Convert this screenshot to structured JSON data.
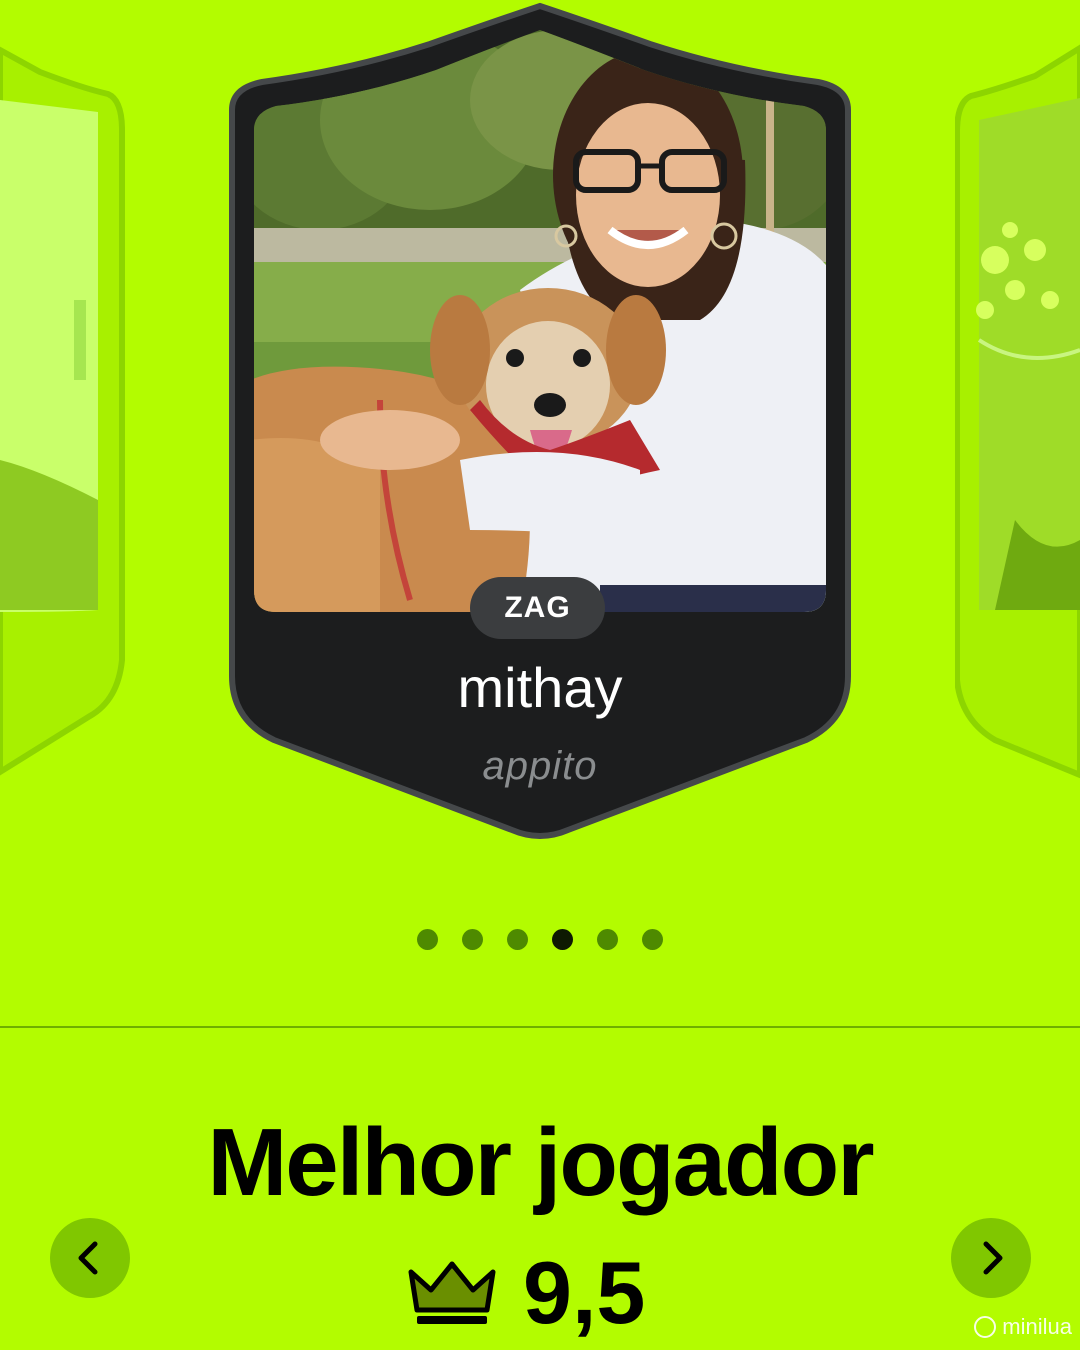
{
  "carousel": {
    "current_card": {
      "position": "ZAG",
      "player_name": "mithay",
      "brand": "appito",
      "photo": "woman-with-dog-photo"
    },
    "dots_total": 6,
    "active_dot_index": 3
  },
  "award": {
    "title": "Melhor jogador",
    "score": "9,5",
    "icon": "crown-icon"
  },
  "navigation": {
    "prev_icon": "chevron-left-icon",
    "next_icon": "chevron-right-icon"
  },
  "watermark": {
    "text": "minilua"
  },
  "colors": {
    "background": "#b3fc00",
    "card": "#1c1d1e",
    "nav_button": "#80c700",
    "active_dot": "#0e1a02",
    "inactive_dot": "#4e8a00"
  }
}
